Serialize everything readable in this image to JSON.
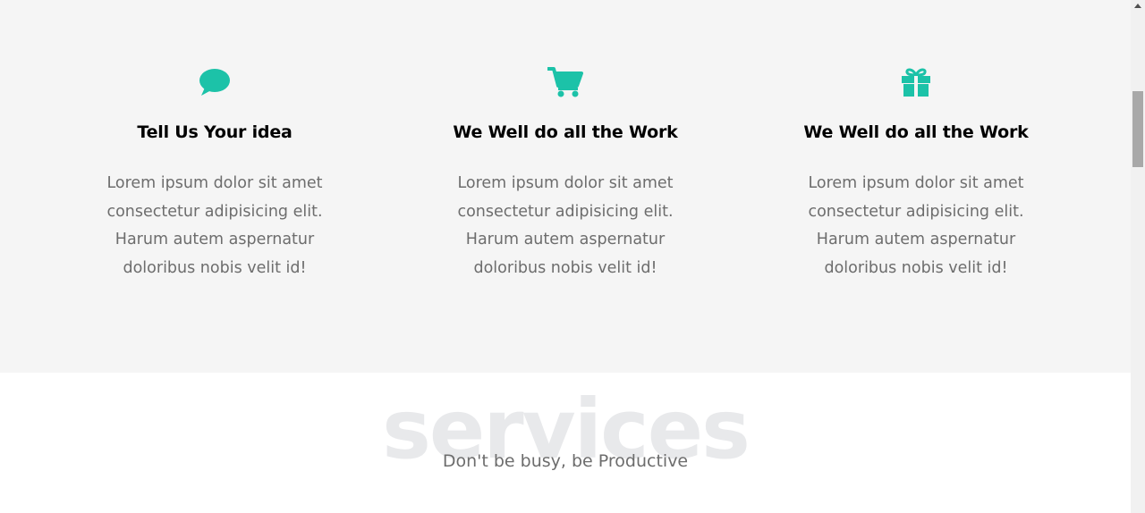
{
  "features": [
    {
      "icon": "speech-bubble-icon",
      "title": "Tell Us Your idea",
      "text": "Lorem ipsum dolor sit amet consectetur adipisicing elit. Harum autem aspernatur doloribus nobis velit id!"
    },
    {
      "icon": "shopping-cart-icon",
      "title": "We Well do all the Work",
      "text": "Lorem ipsum dolor sit amet consectetur adipisicing elit. Harum autem aspernatur doloribus nobis velit id!"
    },
    {
      "icon": "gift-icon",
      "title": "We Well do all the Work",
      "text": "Lorem ipsum dolor sit amet consectetur adipisicing elit. Harum autem aspernatur doloribus nobis velit id!"
    }
  ],
  "services": {
    "heading": "services",
    "tagline": "Don't be busy, be Productive"
  },
  "colors": {
    "accent": "#1cc2a8",
    "feature_bg": "#f5f5f5",
    "body_text": "#6d6d6d",
    "watermark": "#e8e9eb"
  }
}
